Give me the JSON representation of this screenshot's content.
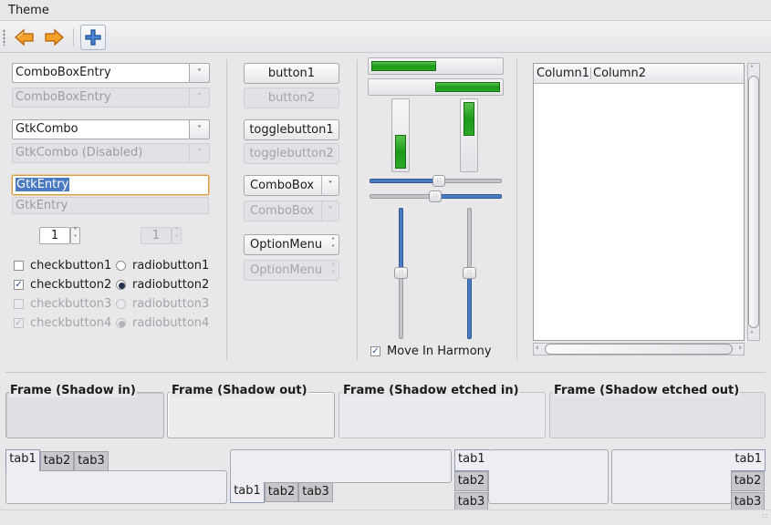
{
  "menubar": {
    "theme": "Theme"
  },
  "toolbar": {
    "back_icon": "arrow-left-icon",
    "forward_icon": "arrow-right-icon",
    "add_icon": "plus-icon",
    "accent": "#e8890c"
  },
  "col1": {
    "combo_entry": "ComboBoxEntry",
    "combo_entry_disabled": "ComboBoxEntry",
    "gtk_combo": "GtkCombo",
    "gtk_combo_disabled": "GtkCombo (Disabled)",
    "entry": "GtkEntry",
    "entry_disabled": "GtkEntry",
    "spin1": "1",
    "spin2": "1",
    "checkbuttons": [
      {
        "label": "checkbutton1",
        "checked": false,
        "disabled": false
      },
      {
        "label": "checkbutton2",
        "checked": true,
        "disabled": false
      },
      {
        "label": "checkbutton3",
        "checked": false,
        "disabled": true
      },
      {
        "label": "checkbutton4",
        "checked": true,
        "disabled": true
      }
    ],
    "radiobuttons": [
      {
        "label": "radiobutton1",
        "selected": false,
        "disabled": false
      },
      {
        "label": "radiobutton2",
        "selected": true,
        "disabled": false
      },
      {
        "label": "radiobutton3",
        "selected": false,
        "disabled": true
      },
      {
        "label": "radiobutton4",
        "selected": true,
        "disabled": true
      }
    ]
  },
  "col2": {
    "button1": "button1",
    "button2": "button2",
    "toggle1": "togglebutton1",
    "toggle2": "togglebutton2",
    "combobox": "ComboBox",
    "combobox_disabled": "ComboBox",
    "optionmenu": "OptionMenu",
    "optionmenu_disabled": "OptionMenu"
  },
  "col3": {
    "progress_h1": 0.5,
    "progress_h2": 0.5,
    "progress_v1": 0.5,
    "progress_v2": 0.5,
    "slider_h1": 0.5,
    "slider_h2": 0.5,
    "slider_v1": 0.5,
    "slider_v2": 0.5,
    "harmony_label": "Move In Harmony",
    "harmony_checked": true
  },
  "treeview": {
    "columns": [
      "Column1",
      "Column2"
    ]
  },
  "frames": [
    {
      "title": "Frame (Shadow in)"
    },
    {
      "title": "Frame (Shadow out)"
    },
    {
      "title": "Frame (Shadow etched in)"
    },
    {
      "title": "Frame (Shadow etched out)"
    }
  ],
  "notebooks": [
    {
      "tabs": [
        "tab1",
        "tab2",
        "tab3"
      ],
      "position": "top",
      "active": 0
    },
    {
      "tabs": [
        "tab1",
        "tab2",
        "tab3"
      ],
      "position": "bottom",
      "active": 0
    },
    {
      "tabs": [
        "tab1",
        "tab2",
        "tab3"
      ],
      "position": "left",
      "active": 0
    },
    {
      "tabs": [
        "tab1",
        "tab2",
        "tab3"
      ],
      "position": "right",
      "active": 0
    }
  ]
}
